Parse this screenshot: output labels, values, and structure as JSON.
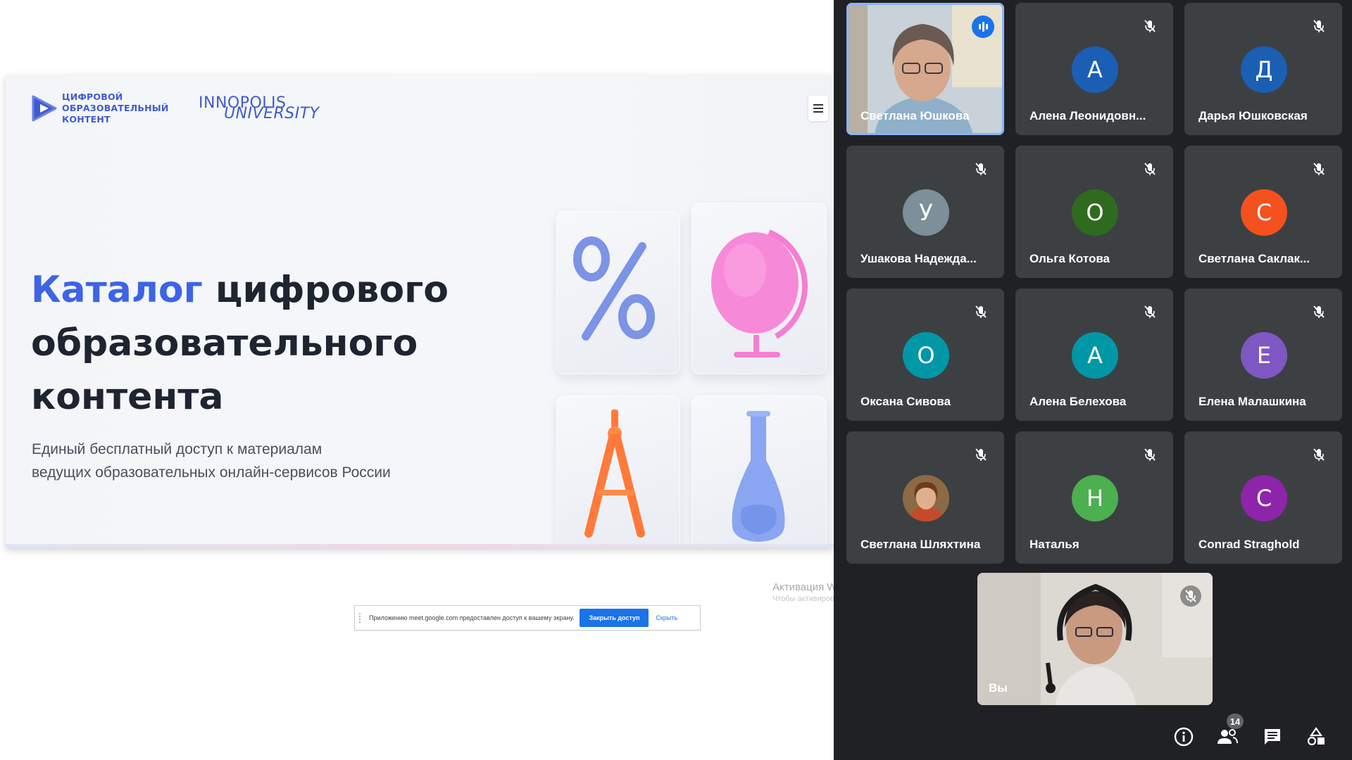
{
  "presentation": {
    "logo_cdc_lines": [
      "ЦИФРОВОЙ",
      "ОБРАЗОВАТЕЛЬНЫЙ",
      "КОНТЕНТ"
    ],
    "logo_innopolis_line1": "INNOPOLIS",
    "logo_innopolis_line2": "UNIVERSITY",
    "title_accent": "Каталог",
    "title_rest_1": " цифрового",
    "title_rest_2": "образовательного",
    "title_rest_3": "контента",
    "subtitle_1": "Единый бесплатный доступ к материалам",
    "subtitle_2": "ведущих образовательных онлайн-сервисов России",
    "tile_percent_glyph": "%"
  },
  "share_bar": {
    "message": "Приложению meet.google.com предоставлен доступ к вашему экрану.",
    "stop_label": "Закрыть доступ",
    "hide_label": "Скрыть"
  },
  "watermark": {
    "line1": "Активация Windows",
    "line2": "Чтобы активировать Windows"
  },
  "participants": [
    {
      "name": "Светлана Юшкова",
      "initial": "",
      "color": "",
      "photo": true,
      "speaking": true
    },
    {
      "name": "Алена Леонидовн...",
      "initial": "А",
      "color": "#1a5fb4"
    },
    {
      "name": "Дарья Юшковская",
      "initial": "Д",
      "color": "#1a5fb4"
    },
    {
      "name": "Ушакова Надежда...",
      "initial": "У",
      "color": "#7d8f99"
    },
    {
      "name": "Ольга Котова",
      "initial": "О",
      "color": "#2e6b1f"
    },
    {
      "name": "Светлана Саклак...",
      "initial": "С",
      "color": "#f4511e"
    },
    {
      "name": "Оксана Сивова",
      "initial": "О",
      "color": "#0097a7"
    },
    {
      "name": "Алена Белехова",
      "initial": "А",
      "color": "#0097a7"
    },
    {
      "name": "Елена Малашкина",
      "initial": "Е",
      "color": "#7e57c2"
    },
    {
      "name": "Светлана Шляхтина",
      "initial": "",
      "color": "",
      "photo": true
    },
    {
      "name": "Наталья",
      "initial": "Н",
      "color": "#4caf50"
    },
    {
      "name": "Conrad Straghold",
      "initial": "С",
      "color": "#8e24aa"
    }
  ],
  "self_tile": {
    "name": "Вы"
  },
  "toolbar": {
    "participants_count": "14"
  },
  "icons": [
    "info-icon",
    "people-icon",
    "chat-icon",
    "activities-icon",
    "mic-off-icon",
    "speaking-icon",
    "menu-icon"
  ]
}
